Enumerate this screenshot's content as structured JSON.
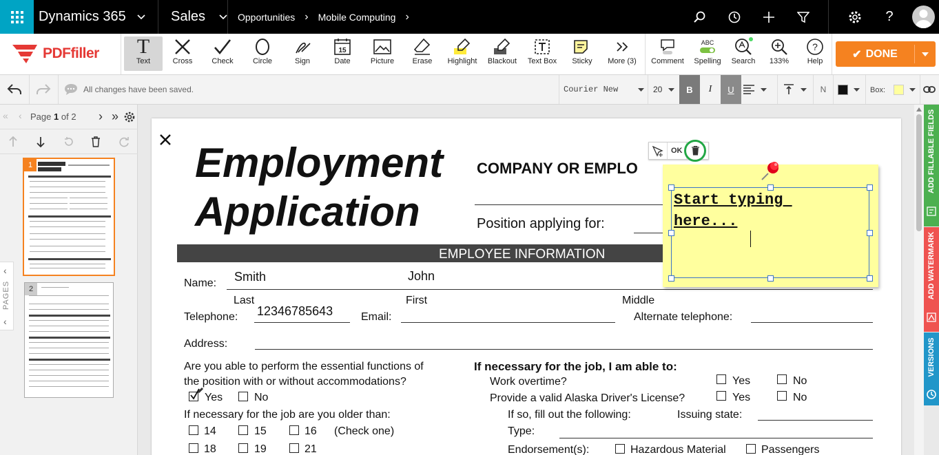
{
  "topbar": {
    "app_name": "Dynamics 365",
    "module": "Sales",
    "breadcrumb": [
      "Opportunities",
      "Mobile Computing"
    ]
  },
  "toolbar": {
    "logo": "PDFfiller",
    "tools": [
      {
        "label": "Text",
        "icon": "text-icon"
      },
      {
        "label": "Cross",
        "icon": "cross-icon"
      },
      {
        "label": "Check",
        "icon": "check-icon"
      },
      {
        "label": "Circle",
        "icon": "circle-icon"
      },
      {
        "label": "Sign",
        "icon": "sign-icon"
      },
      {
        "label": "Date",
        "icon": "date-icon"
      },
      {
        "label": "Picture",
        "icon": "picture-icon"
      },
      {
        "label": "Erase",
        "icon": "erase-icon"
      },
      {
        "label": "Highlight",
        "icon": "highlight-icon"
      },
      {
        "label": "Blackout",
        "icon": "blackout-icon"
      },
      {
        "label": "Text Box",
        "icon": "text-box-icon"
      },
      {
        "label": "Sticky",
        "icon": "sticky-icon"
      },
      {
        "label": "More (3)",
        "icon": "more-icon"
      },
      {
        "label": "Comment",
        "icon": "comment-icon"
      },
      {
        "label": "Spelling",
        "icon": "spelling-icon"
      },
      {
        "label": "Search",
        "icon": "search-icon"
      },
      {
        "label": "133%",
        "icon": "zoom-icon"
      },
      {
        "label": "Help",
        "icon": "help-icon"
      }
    ],
    "spelling_badge": "ABC",
    "done_label": "DONE"
  },
  "format_bar": {
    "status": "All changes have been saved.",
    "font_family": "Courier New",
    "font_size": "20",
    "bold": "B",
    "italic": "I",
    "underline": "U",
    "normal": "N",
    "box_label": "Box:"
  },
  "pager": {
    "page_prefix": "Page",
    "current": "1",
    "of": "of 2",
    "thumbs": [
      "1",
      "2"
    ],
    "pages_tab": "PAGES"
  },
  "right_tabs": [
    {
      "label": "ADD FILLABLE FIELDS",
      "color": "#4cb050"
    },
    {
      "label": "ADD WATERMARK",
      "color": "#ef5350"
    },
    {
      "label": "VERSIONS",
      "color": "#2196c9"
    }
  ],
  "sticky": {
    "ok_label": "OK",
    "text": "Start typing \nhere..."
  },
  "document": {
    "title_1": "Employment",
    "title_2": "Application",
    "company_label": "COMPANY OR EMPLO",
    "position_label": "Position applying for:",
    "section_header": "EMPLOYEE INFORMATION",
    "name_label": "Name:",
    "last_name": "Smith",
    "first_name": "John",
    "last_caption": "Last",
    "first_caption": "First",
    "middle_caption": "Middle",
    "telephone_label": "Telephone:",
    "telephone_value": "12346785643",
    "email_label": "Email:",
    "alt_phone_label": "Alternate telephone:",
    "address_label": "Address:",
    "q_essential_1": "Are you able to perform the essential functions of",
    "q_essential_2": "the position with or without accommodations?",
    "yes": "Yes",
    "no": "No",
    "q_older": "If necessary for the job are you older than:",
    "ages": [
      "14",
      "15",
      "16",
      "18",
      "19",
      "21"
    ],
    "check_one": "(Check one)",
    "able_header": "If necessary for the job, I am able to:",
    "work_overtime": "Work overtime?",
    "license_q": "Provide a valid Alaska Driver's License?",
    "if_so": "If so, fill out the following:",
    "issuing_state": "Issuing state:",
    "type_label": "Type:",
    "endorsements": "Endorsement(s):",
    "hazardous": "Hazardous Material",
    "passengers": "Passengers"
  }
}
